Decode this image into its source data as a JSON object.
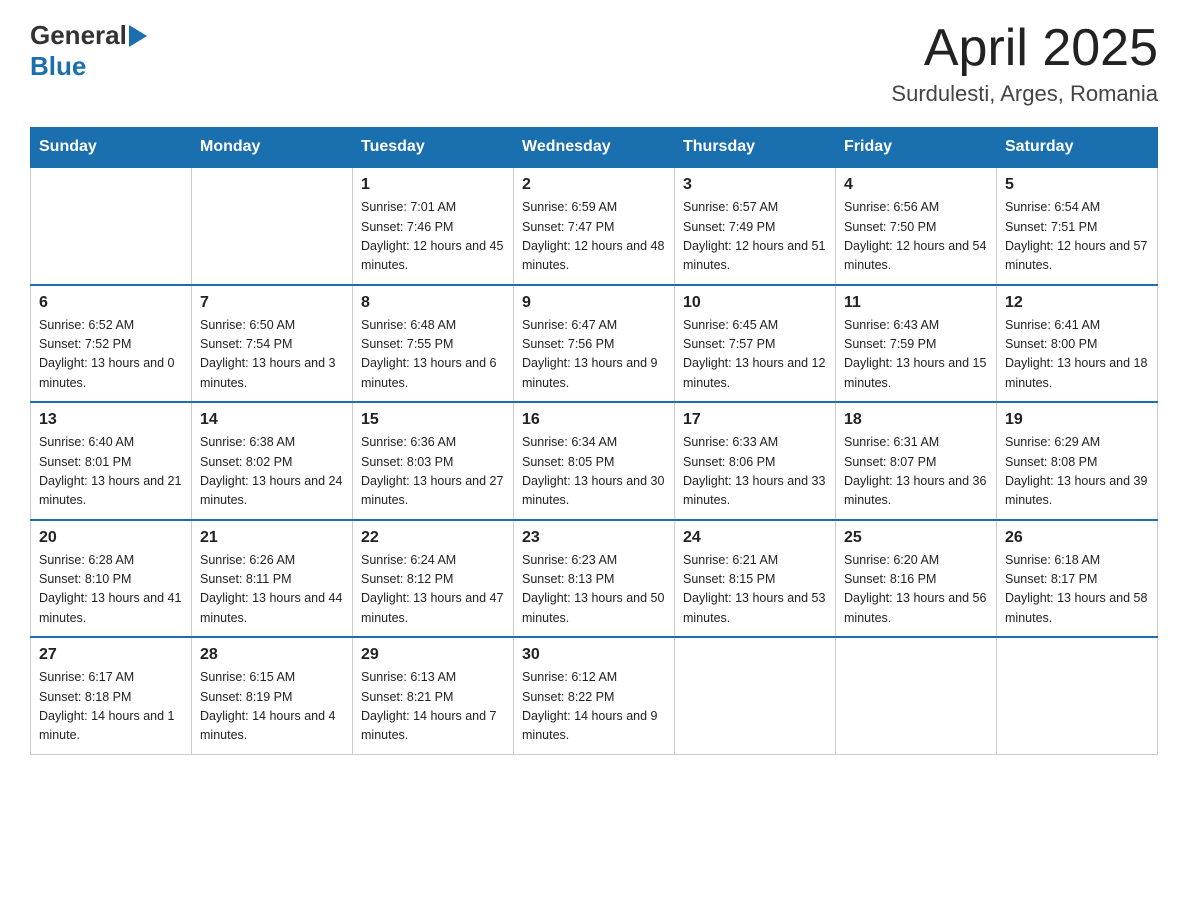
{
  "header": {
    "logo_general": "General",
    "logo_blue": "Blue",
    "month_title": "April 2025",
    "location": "Surdulesti, Arges, Romania"
  },
  "weekdays": [
    "Sunday",
    "Monday",
    "Tuesday",
    "Wednesday",
    "Thursday",
    "Friday",
    "Saturday"
  ],
  "weeks": [
    [
      {
        "day": "",
        "sunrise": "",
        "sunset": "",
        "daylight": ""
      },
      {
        "day": "",
        "sunrise": "",
        "sunset": "",
        "daylight": ""
      },
      {
        "day": "1",
        "sunrise": "Sunrise: 7:01 AM",
        "sunset": "Sunset: 7:46 PM",
        "daylight": "Daylight: 12 hours and 45 minutes."
      },
      {
        "day": "2",
        "sunrise": "Sunrise: 6:59 AM",
        "sunset": "Sunset: 7:47 PM",
        "daylight": "Daylight: 12 hours and 48 minutes."
      },
      {
        "day": "3",
        "sunrise": "Sunrise: 6:57 AM",
        "sunset": "Sunset: 7:49 PM",
        "daylight": "Daylight: 12 hours and 51 minutes."
      },
      {
        "day": "4",
        "sunrise": "Sunrise: 6:56 AM",
        "sunset": "Sunset: 7:50 PM",
        "daylight": "Daylight: 12 hours and 54 minutes."
      },
      {
        "day": "5",
        "sunrise": "Sunrise: 6:54 AM",
        "sunset": "Sunset: 7:51 PM",
        "daylight": "Daylight: 12 hours and 57 minutes."
      }
    ],
    [
      {
        "day": "6",
        "sunrise": "Sunrise: 6:52 AM",
        "sunset": "Sunset: 7:52 PM",
        "daylight": "Daylight: 13 hours and 0 minutes."
      },
      {
        "day": "7",
        "sunrise": "Sunrise: 6:50 AM",
        "sunset": "Sunset: 7:54 PM",
        "daylight": "Daylight: 13 hours and 3 minutes."
      },
      {
        "day": "8",
        "sunrise": "Sunrise: 6:48 AM",
        "sunset": "Sunset: 7:55 PM",
        "daylight": "Daylight: 13 hours and 6 minutes."
      },
      {
        "day": "9",
        "sunrise": "Sunrise: 6:47 AM",
        "sunset": "Sunset: 7:56 PM",
        "daylight": "Daylight: 13 hours and 9 minutes."
      },
      {
        "day": "10",
        "sunrise": "Sunrise: 6:45 AM",
        "sunset": "Sunset: 7:57 PM",
        "daylight": "Daylight: 13 hours and 12 minutes."
      },
      {
        "day": "11",
        "sunrise": "Sunrise: 6:43 AM",
        "sunset": "Sunset: 7:59 PM",
        "daylight": "Daylight: 13 hours and 15 minutes."
      },
      {
        "day": "12",
        "sunrise": "Sunrise: 6:41 AM",
        "sunset": "Sunset: 8:00 PM",
        "daylight": "Daylight: 13 hours and 18 minutes."
      }
    ],
    [
      {
        "day": "13",
        "sunrise": "Sunrise: 6:40 AM",
        "sunset": "Sunset: 8:01 PM",
        "daylight": "Daylight: 13 hours and 21 minutes."
      },
      {
        "day": "14",
        "sunrise": "Sunrise: 6:38 AM",
        "sunset": "Sunset: 8:02 PM",
        "daylight": "Daylight: 13 hours and 24 minutes."
      },
      {
        "day": "15",
        "sunrise": "Sunrise: 6:36 AM",
        "sunset": "Sunset: 8:03 PM",
        "daylight": "Daylight: 13 hours and 27 minutes."
      },
      {
        "day": "16",
        "sunrise": "Sunrise: 6:34 AM",
        "sunset": "Sunset: 8:05 PM",
        "daylight": "Daylight: 13 hours and 30 minutes."
      },
      {
        "day": "17",
        "sunrise": "Sunrise: 6:33 AM",
        "sunset": "Sunset: 8:06 PM",
        "daylight": "Daylight: 13 hours and 33 minutes."
      },
      {
        "day": "18",
        "sunrise": "Sunrise: 6:31 AM",
        "sunset": "Sunset: 8:07 PM",
        "daylight": "Daylight: 13 hours and 36 minutes."
      },
      {
        "day": "19",
        "sunrise": "Sunrise: 6:29 AM",
        "sunset": "Sunset: 8:08 PM",
        "daylight": "Daylight: 13 hours and 39 minutes."
      }
    ],
    [
      {
        "day": "20",
        "sunrise": "Sunrise: 6:28 AM",
        "sunset": "Sunset: 8:10 PM",
        "daylight": "Daylight: 13 hours and 41 minutes."
      },
      {
        "day": "21",
        "sunrise": "Sunrise: 6:26 AM",
        "sunset": "Sunset: 8:11 PM",
        "daylight": "Daylight: 13 hours and 44 minutes."
      },
      {
        "day": "22",
        "sunrise": "Sunrise: 6:24 AM",
        "sunset": "Sunset: 8:12 PM",
        "daylight": "Daylight: 13 hours and 47 minutes."
      },
      {
        "day": "23",
        "sunrise": "Sunrise: 6:23 AM",
        "sunset": "Sunset: 8:13 PM",
        "daylight": "Daylight: 13 hours and 50 minutes."
      },
      {
        "day": "24",
        "sunrise": "Sunrise: 6:21 AM",
        "sunset": "Sunset: 8:15 PM",
        "daylight": "Daylight: 13 hours and 53 minutes."
      },
      {
        "day": "25",
        "sunrise": "Sunrise: 6:20 AM",
        "sunset": "Sunset: 8:16 PM",
        "daylight": "Daylight: 13 hours and 56 minutes."
      },
      {
        "day": "26",
        "sunrise": "Sunrise: 6:18 AM",
        "sunset": "Sunset: 8:17 PM",
        "daylight": "Daylight: 13 hours and 58 minutes."
      }
    ],
    [
      {
        "day": "27",
        "sunrise": "Sunrise: 6:17 AM",
        "sunset": "Sunset: 8:18 PM",
        "daylight": "Daylight: 14 hours and 1 minute."
      },
      {
        "day": "28",
        "sunrise": "Sunrise: 6:15 AM",
        "sunset": "Sunset: 8:19 PM",
        "daylight": "Daylight: 14 hours and 4 minutes."
      },
      {
        "day": "29",
        "sunrise": "Sunrise: 6:13 AM",
        "sunset": "Sunset: 8:21 PM",
        "daylight": "Daylight: 14 hours and 7 minutes."
      },
      {
        "day": "30",
        "sunrise": "Sunrise: 6:12 AM",
        "sunset": "Sunset: 8:22 PM",
        "daylight": "Daylight: 14 hours and 9 minutes."
      },
      {
        "day": "",
        "sunrise": "",
        "sunset": "",
        "daylight": ""
      },
      {
        "day": "",
        "sunrise": "",
        "sunset": "",
        "daylight": ""
      },
      {
        "day": "",
        "sunrise": "",
        "sunset": "",
        "daylight": ""
      }
    ]
  ]
}
